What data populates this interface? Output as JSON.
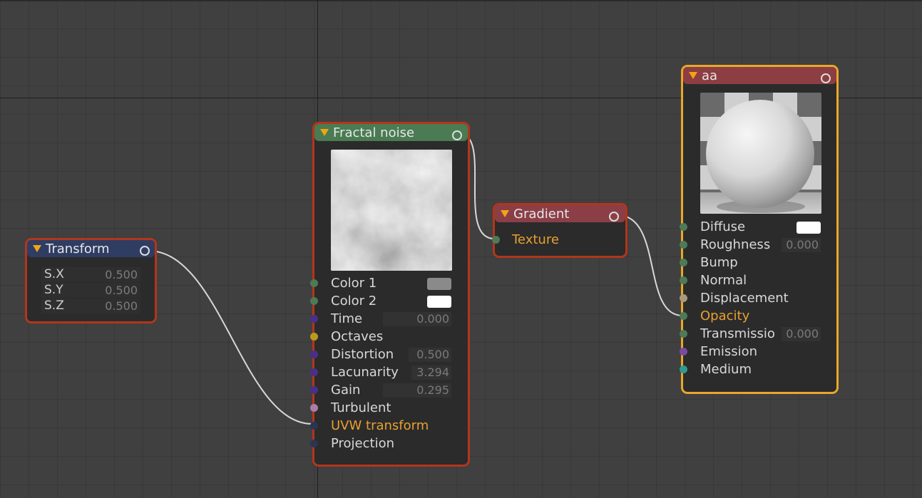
{
  "nodes": {
    "transform": {
      "title": "Transform",
      "rows": [
        {
          "label": "S.X",
          "value": "0.500"
        },
        {
          "label": "S.Y",
          "value": "0.500"
        },
        {
          "label": "S.Z",
          "value": "0.500"
        }
      ]
    },
    "fractal_noise": {
      "title": "Fractal noise",
      "rows": [
        {
          "label": "Color 1",
          "value": ""
        },
        {
          "label": "Color 2",
          "value": ""
        },
        {
          "label": "Time",
          "value": "0.000"
        },
        {
          "label": "Octaves",
          "value": ""
        },
        {
          "label": "Distortion",
          "value": "0.500"
        },
        {
          "label": "Lacunarity",
          "value": "3.294"
        },
        {
          "label": "Gain",
          "value": "0.295"
        },
        {
          "label": "Turbulent",
          "value": ""
        },
        {
          "label": "UVW transform",
          "value": ""
        },
        {
          "label": "Projection",
          "value": ""
        }
      ]
    },
    "gradient": {
      "title": "Gradient",
      "rows": [
        {
          "label": "Texture"
        }
      ]
    },
    "material": {
      "title": "aa",
      "rows": [
        {
          "label": "Diffuse",
          "value": ""
        },
        {
          "label": "Roughness",
          "value": "0.000"
        },
        {
          "label": "Bump",
          "value": ""
        },
        {
          "label": "Normal",
          "value": ""
        },
        {
          "label": "Displacement",
          "value": ""
        },
        {
          "label": "Opacity",
          "value": ""
        },
        {
          "label": "Transmissio",
          "value": "0.000"
        },
        {
          "label": "Emission",
          "value": ""
        },
        {
          "label": "Medium",
          "value": ""
        }
      ]
    }
  },
  "colors": {
    "header_transform": "#2f3d63",
    "header_fractal": "#4a7b52",
    "header_gradient": "#8c3e47",
    "header_material": "#8c3e42",
    "node_border": "#b2361b",
    "node_border_selected": "#e9a72a",
    "active_label": "#e8a030",
    "swatch_color1": "#8a8a8a",
    "swatch_color2": "#ffffff",
    "swatch_diffuse": "#ffffff"
  },
  "icons": {
    "collapse": "triangle-down-icon",
    "output": "output-port-icon",
    "input": "input-port-icon"
  }
}
